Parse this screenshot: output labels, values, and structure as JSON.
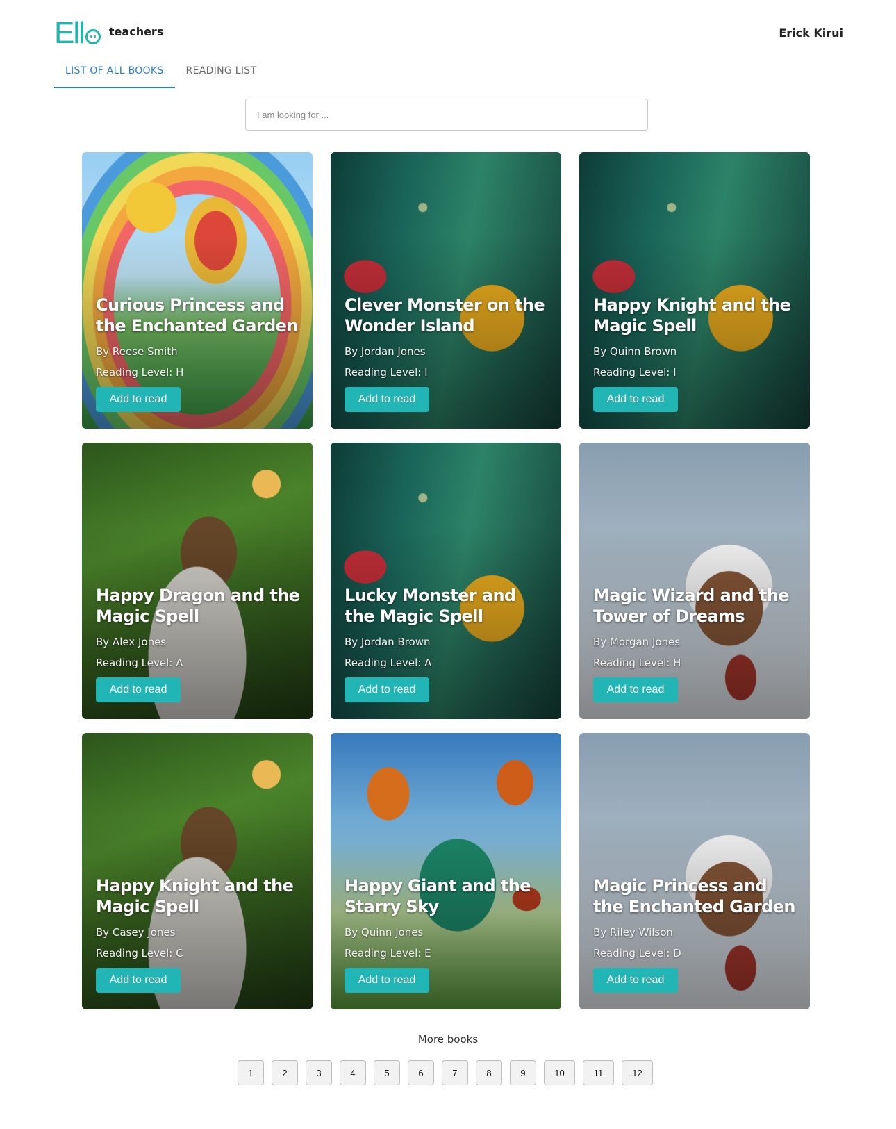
{
  "header": {
    "logo_mark": "Ell",
    "logo_text": "teachers",
    "user_name": "Erick Kirui"
  },
  "tabs": [
    {
      "label": "LIST OF ALL BOOKS",
      "active": true
    },
    {
      "label": "READING LIST",
      "active": false
    }
  ],
  "search": {
    "placeholder": "I am looking for ...",
    "value": ""
  },
  "books": [
    {
      "title": "Curious Princess and the Enchanted Garden",
      "author": "By Reese Smith",
      "level": "Reading Level: H",
      "button": "Add to read",
      "cover": "balloon"
    },
    {
      "title": "Clever Monster on the Wonder Island",
      "author": "By Jordan Jones",
      "level": "Reading Level: I",
      "button": "Add to read",
      "cover": "forest"
    },
    {
      "title": "Happy Knight and the Magic Spell",
      "author": "By Quinn Brown",
      "level": "Reading Level: I",
      "button": "Add to read",
      "cover": "forest"
    },
    {
      "title": "Happy Dragon and the Magic Spell",
      "author": "By Alex Jones",
      "level": "Reading Level: A",
      "button": "Add to read",
      "cover": "tea"
    },
    {
      "title": "Lucky Monster and the Magic Spell",
      "author": "By Jordan Brown",
      "level": "Reading Level: A",
      "button": "Add to read",
      "cover": "forest"
    },
    {
      "title": "Magic Wizard and the Tower of Dreams",
      "author": "By Morgan Jones",
      "level": "Reading Level: H",
      "button": "Add to read",
      "cover": "snow"
    },
    {
      "title": "Happy Knight and the Magic Spell",
      "author": "By Casey Jones",
      "level": "Reading Level: C",
      "button": "Add to read",
      "cover": "tea"
    },
    {
      "title": "Happy Giant and the Starry Sky",
      "author": "By Quinn Jones",
      "level": "Reading Level: E",
      "button": "Add to read",
      "cover": "dino"
    },
    {
      "title": "Magic Princess and the Enchanted Garden",
      "author": "By Riley Wilson",
      "level": "Reading Level: D",
      "button": "Add to read",
      "cover": "snow"
    }
  ],
  "more_books_label": "More books",
  "pages": [
    "1",
    "2",
    "3",
    "4",
    "5",
    "6",
    "7",
    "8",
    "9",
    "10",
    "11",
    "12"
  ]
}
